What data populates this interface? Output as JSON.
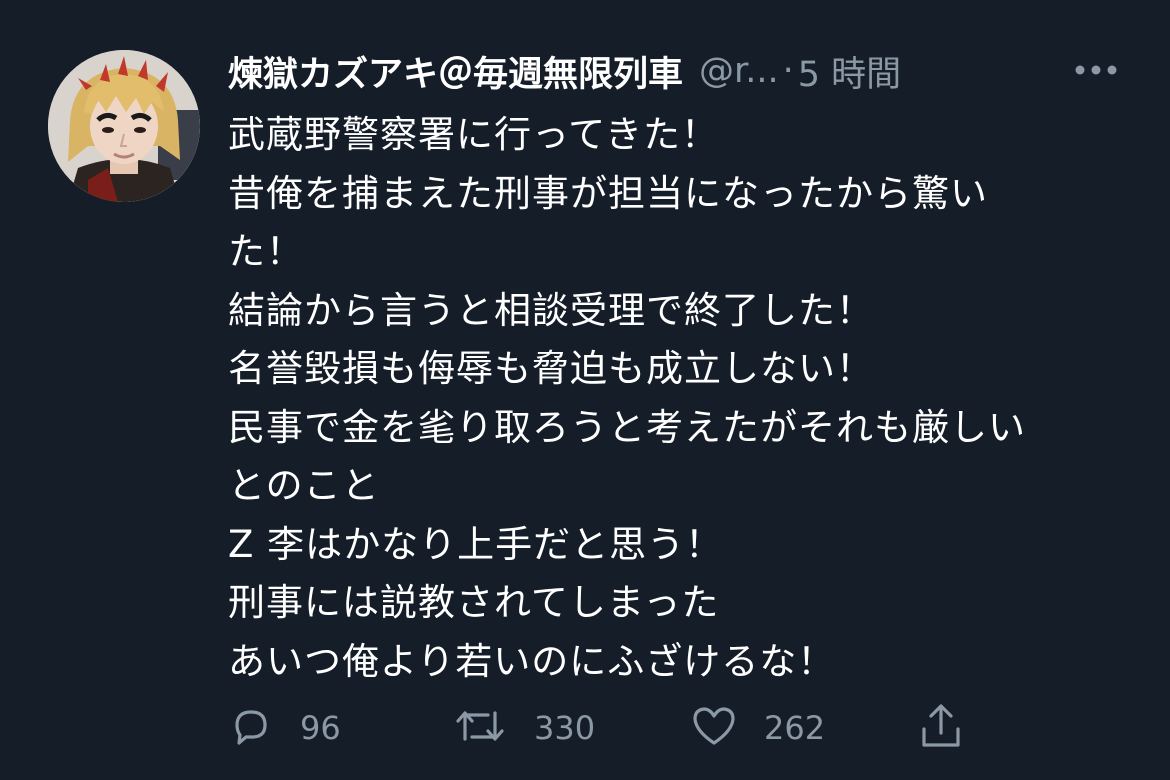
{
  "tweet": {
    "display_name": "煉獄カズアキ＠毎週無限列車",
    "handle": "@r...",
    "separator": "·",
    "time": "5 時間",
    "lines": [
      "武蔵野警察署に行ってきた！",
      "昔俺を捕まえた刑事が担当になったから驚い",
      "た！",
      "結論から言うと相談受理で終了した！",
      "名誉毀損も侮辱も脅迫も成立しない！",
      "民事で金を毟り取ろうと考えたがそれも厳しい",
      "とのこと",
      "Z 李はかなり上手だと思う！",
      "刑事には説教されてしまった",
      "あいつ俺より若いのにふざけるな！"
    ]
  },
  "actions": {
    "reply_count": "96",
    "retweet_count": "330",
    "like_count": "262"
  },
  "icons": {
    "avatar": "avatar-photo",
    "more": "more-options-icon",
    "reply": "reply-icon",
    "retweet": "retweet-icon",
    "like": "heart-icon",
    "share": "share-icon"
  },
  "colors": {
    "background": "#151d28",
    "text": "#ffffff",
    "secondary": "#8b98a5"
  }
}
